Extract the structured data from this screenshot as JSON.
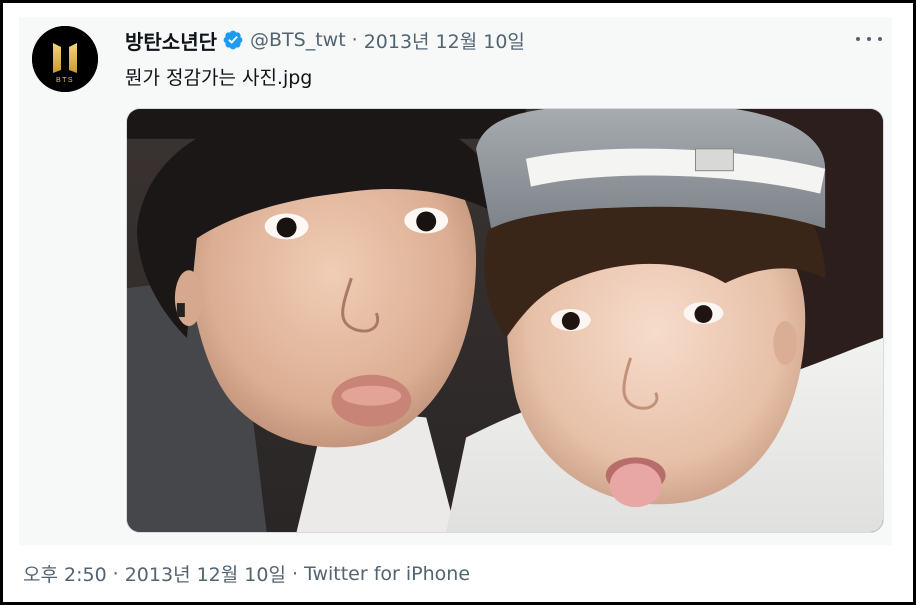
{
  "tweet": {
    "display_name": "방탄소년단",
    "verified_icon": "verified-badge-icon",
    "handle": "@BTS_twt",
    "separator": "·",
    "date": "2013년 12월 10일",
    "text": "뭔가 정감가는 사진.jpg",
    "avatar_logo_text": "BTS",
    "more_icon": "more-options-icon"
  },
  "meta": {
    "time": "오후 2:50",
    "separator": "·",
    "date": "2013년 12월 10일",
    "source": "Twitter for iPhone"
  },
  "colors": {
    "verified_blue": "#1d9bf0",
    "secondary_text": "#536471",
    "primary_text": "#0f1419",
    "logo_gold": "#e9c45a"
  }
}
